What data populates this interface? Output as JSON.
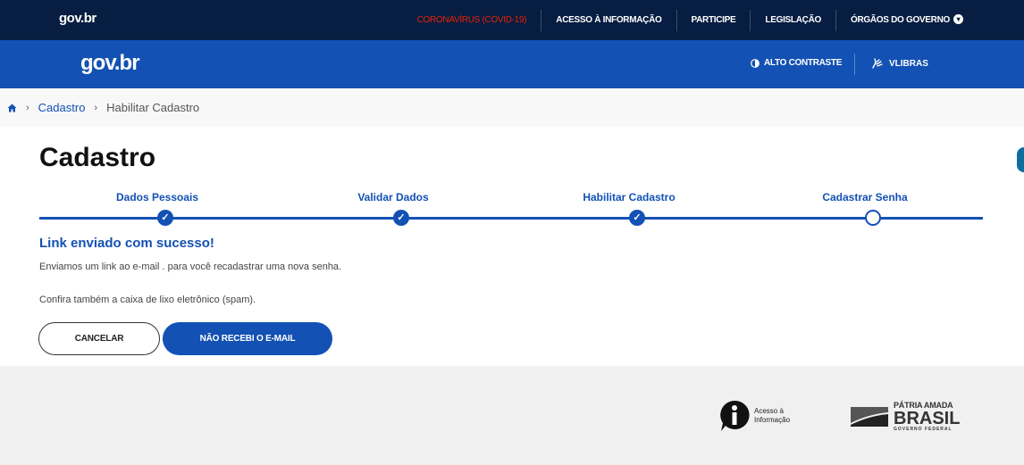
{
  "topbar": {
    "logo": "gov.br",
    "nav": [
      {
        "label": "CORONAVÍRUS (COVID-19)",
        "style": "covid"
      },
      {
        "label": "ACESSO À INFORMAÇÃO"
      },
      {
        "label": "PARTICIPE"
      },
      {
        "label": "LEGISLAÇÃO"
      },
      {
        "label": "ÓRGÃOS DO GOVERNO"
      }
    ]
  },
  "header": {
    "logo": "gov.br",
    "contrast_label": "ALTO CONTRASTE",
    "vlibras_label": "VLIBRAS"
  },
  "breadcrumb": {
    "items": [
      "Cadastro",
      "Habilitar Cadastro"
    ]
  },
  "page": {
    "title": "Cadastro"
  },
  "steps": [
    {
      "label": "Dados Pessoais",
      "done": true
    },
    {
      "label": "Validar Dados",
      "done": true
    },
    {
      "label": "Habilitar Cadastro",
      "done": true
    },
    {
      "label": "Cadastrar Senha",
      "done": false
    }
  ],
  "message": {
    "title": "Link enviado com sucesso!",
    "line1": "Enviamos um link ao e-mail . para você recadastrar uma nova senha.",
    "line2": "Confira também a caixa de lixo eletrônico (spam)."
  },
  "buttons": {
    "cancel": "CANCELAR",
    "resend": "NÃO RECEBI O E-MAIL"
  },
  "footer": {
    "acesso_line1": "Acesso à",
    "acesso_line2": "Informação",
    "patria_top": "PÁTRIA AMADA",
    "patria_mid": "BRASIL",
    "patria_bot": "GOVERNO FEDERAL"
  },
  "colors": {
    "navy": "#071d41",
    "brand_blue": "#1351b4",
    "covid_red": "#e52207",
    "footer_bg": "#f0f0f0"
  }
}
